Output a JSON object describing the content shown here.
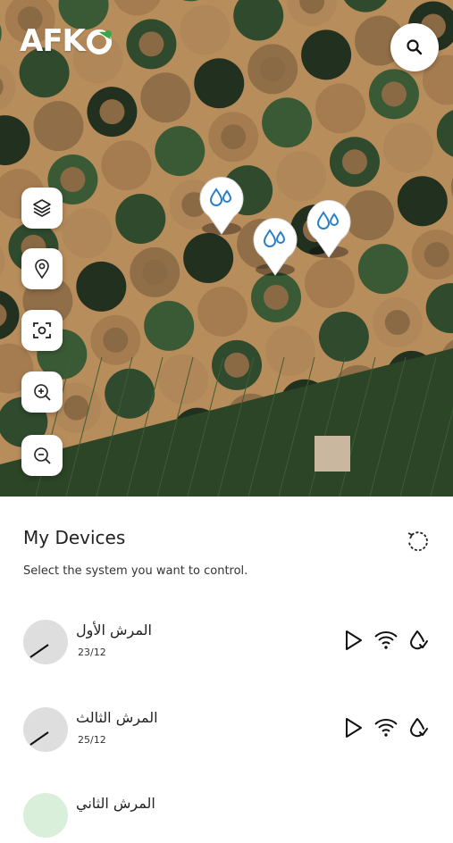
{
  "app": {
    "logo_text": "AFK"
  },
  "map": {
    "controls": [
      {
        "name": "layers-button",
        "icon": "layers-icon"
      },
      {
        "name": "location-button",
        "icon": "location-pin-icon"
      },
      {
        "name": "focus-button",
        "icon": "focus-frame-icon"
      },
      {
        "name": "zoom-in-button",
        "icon": "zoom-in-icon"
      },
      {
        "name": "zoom-out-button",
        "icon": "zoom-out-icon"
      }
    ],
    "search_icon": "search-icon",
    "pins": [
      {
        "name": "map-pin-1",
        "icon": "water-drop-icon"
      },
      {
        "name": "map-pin-2",
        "icon": "water-drop-icon"
      },
      {
        "name": "map-pin-3",
        "icon": "water-drop-icon"
      }
    ]
  },
  "devices_panel": {
    "title": "My Devices",
    "subtitle": "Select the system you want to control.",
    "refresh_icon": "refresh-icon",
    "devices": [
      {
        "name": "المرش الأول",
        "date": "23/12"
      },
      {
        "name": "المرش الثالث",
        "date": "25/12"
      },
      {
        "name": "المرش الثاني",
        "date": ""
      }
    ],
    "device_actions": [
      "play-icon",
      "wifi-icon",
      "water-drop-icon"
    ]
  },
  "colors": {
    "accent_blue": "#2b7fc7",
    "logo_green": "#3aa64a",
    "field_dark": "#2f4a2d",
    "desert": "#b88d5c"
  }
}
